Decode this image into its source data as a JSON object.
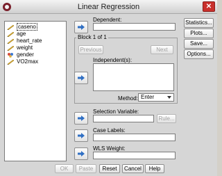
{
  "window": {
    "title": "Linear Regression"
  },
  "variables": [
    {
      "label": "caseno",
      "type": "scale"
    },
    {
      "label": "age",
      "type": "scale"
    },
    {
      "label": "heart_rate",
      "type": "scale"
    },
    {
      "label": "weight",
      "type": "scale"
    },
    {
      "label": "gender",
      "type": "nominal"
    },
    {
      "label": "VO2max",
      "type": "scale"
    }
  ],
  "dependent": {
    "label": "Dependent:",
    "value": ""
  },
  "block": {
    "title": "Block 1 of 1",
    "previous_label": "Previous",
    "next_label": "Next",
    "independents_label": "Independent(s):",
    "method_label": "Method:",
    "method_value": "Enter"
  },
  "selection_variable": {
    "label": "Selection Variable:",
    "rule_label": "Rule..."
  },
  "case_labels": {
    "label": "Case Labels:"
  },
  "wls_weight": {
    "label": "WLS Weight:"
  },
  "side_buttons": {
    "statistics": "Statistics...",
    "plots": "Plots...",
    "save": "Save...",
    "options": "Options..."
  },
  "bottom_buttons": {
    "ok": "OK",
    "paste": "Paste",
    "reset": "Reset",
    "cancel": "Cancel",
    "help": "Help"
  },
  "colors": {
    "arrow_blue": "#2f6fc4",
    "close_red": "#c9302c"
  }
}
